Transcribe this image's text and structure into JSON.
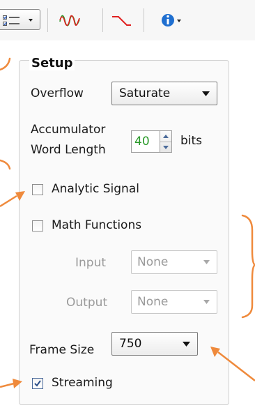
{
  "toolbar": {
    "items": [
      {
        "name": "settings-menu-button",
        "icon": "checklist-icon"
      },
      {
        "name": "waveform-display-button",
        "icon": "waveform-icon"
      },
      {
        "name": "ramp-display-button",
        "icon": "ramp-icon"
      },
      {
        "name": "info-menu-button",
        "icon": "info-icon"
      }
    ]
  },
  "setup": {
    "title": "Setup",
    "overflow": {
      "label": "Overflow",
      "value": "Saturate"
    },
    "accumulator": {
      "label_line1": "Accumulator",
      "label_line2": "Word Length",
      "value": "40",
      "unit": "bits"
    },
    "analytic_signal": {
      "label": "Analytic Signal",
      "checked": false
    },
    "math_functions": {
      "label": "Math Functions",
      "checked": false
    },
    "input": {
      "label": "Input",
      "value": "None"
    },
    "output": {
      "label": "Output",
      "value": "None"
    },
    "frame_size": {
      "label": "Frame Size",
      "value": "750"
    },
    "streaming": {
      "label": "Streaming",
      "checked": true
    }
  },
  "colors": {
    "annotation": "#ef8a3c",
    "accent_green": "#2a9a2a",
    "waveform_red": "#e02020",
    "info_blue": "#1f6fd0",
    "disabled_text": "#9a9a9a"
  }
}
